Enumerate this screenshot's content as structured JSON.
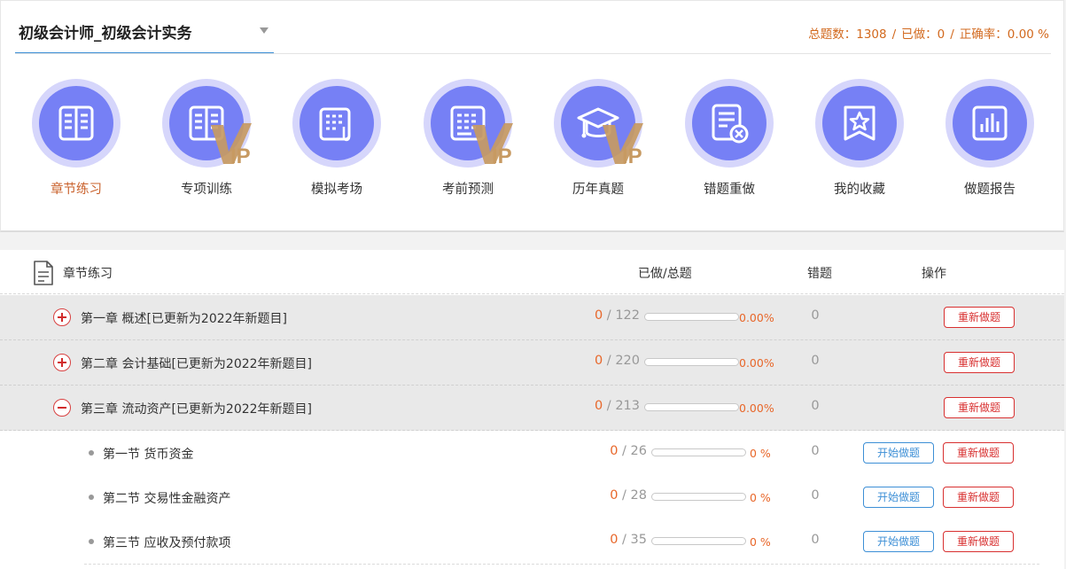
{
  "subject": {
    "title": "初级会计师_初级会计实务"
  },
  "stats": {
    "total": "总题数：1308",
    "done": "已做：0",
    "accuracy": "正确率：0.00 %",
    "separator": "/"
  },
  "modes": [
    {
      "label": "章节练习",
      "icon": "book-icon",
      "vip": false,
      "active": true
    },
    {
      "label": "专项训练",
      "icon": "book-icon",
      "vip": true,
      "active": false
    },
    {
      "label": "模拟考场",
      "icon": "notepad-icon",
      "vip": false,
      "active": false
    },
    {
      "label": "考前预测",
      "icon": "list-icon",
      "vip": true,
      "active": false
    },
    {
      "label": "历年真题",
      "icon": "graduation-cap-icon",
      "vip": true,
      "active": false
    },
    {
      "label": "错题重做",
      "icon": "document-x-icon",
      "vip": false,
      "active": false
    },
    {
      "label": "我的收藏",
      "icon": "star-bookmark-icon",
      "vip": false,
      "active": false
    },
    {
      "label": "做题报告",
      "icon": "bar-chart-icon",
      "vip": false,
      "active": false
    }
  ],
  "vip_text": "VIP",
  "table": {
    "headers": {
      "name": "章节练习",
      "progress": "已做/总题",
      "wrong": "错题",
      "action": "操作"
    },
    "redo_label": "重新做题",
    "start_label": "开始做题",
    "rows": [
      {
        "kind": "chapter",
        "expanded": false,
        "name": "第一章 概述[已更新为2022年新题目]",
        "done": "0",
        "total": "122",
        "percent": "0.00%",
        "progress": 0,
        "wrong": "0"
      },
      {
        "kind": "chapter",
        "expanded": false,
        "name": "第二章 会计基础[已更新为2022年新题目]",
        "done": "0",
        "total": "220",
        "percent": "0.00%",
        "progress": 0,
        "wrong": "0"
      },
      {
        "kind": "chapter",
        "expanded": true,
        "name": "第三章 流动资产[已更新为2022年新题目]",
        "done": "0",
        "total": "213",
        "percent": "0.00%",
        "progress": 0,
        "wrong": "0"
      },
      {
        "kind": "section",
        "name": "第一节 货币资金",
        "done": "0",
        "total": "26",
        "percent": "0 %",
        "progress": 0,
        "wrong": "0"
      },
      {
        "kind": "section",
        "name": "第二节 交易性金融资产",
        "done": "0",
        "total": "28",
        "percent": "0 %",
        "progress": 0,
        "wrong": "0"
      },
      {
        "kind": "section",
        "name": "第三节 应收及预付款项",
        "done": "0",
        "total": "35",
        "percent": "0 %",
        "progress": 0,
        "wrong": "0"
      }
    ]
  },
  "colors": {
    "accent": "#7680f5",
    "ring": "#d6d6fb",
    "vip_gold": "#c79a62",
    "danger": "#d83030",
    "primary": "#3d8fd6",
    "stats": "#d2691e"
  }
}
